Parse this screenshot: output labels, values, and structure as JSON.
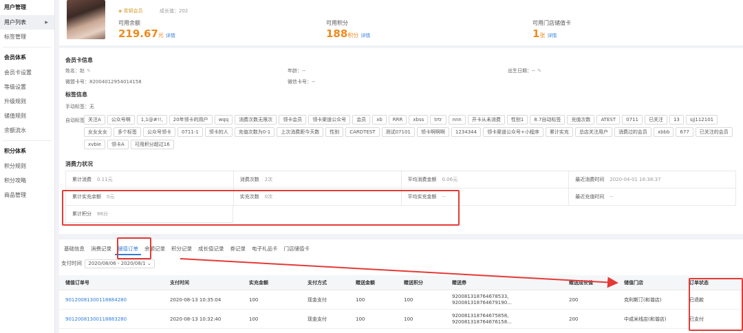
{
  "sidebar": {
    "groups": [
      {
        "title": "用户管理",
        "items": [
          "用户列表",
          "标签管理"
        ]
      },
      {
        "title": "会员体系",
        "items": [
          "会员卡设置",
          "等级设置",
          "升级规则",
          "储值规则",
          "余额流水"
        ]
      },
      {
        "title": "积分体系",
        "items": [
          "积分规则",
          "积分攻略",
          "商品管理"
        ]
      }
    ]
  },
  "profile": {
    "vip": "◈ 青铜会员",
    "growth": "成长值：202",
    "balance_label": "可用余额",
    "balance_value": "219.67",
    "balance_unit": "元",
    "points_label": "可用积分",
    "points_value": "188",
    "points_unit": "积分",
    "cards_label": "可用门店储值卡",
    "cards_value": "1",
    "cards_unit": "张",
    "detail_link": "详情"
  },
  "member_info": {
    "title": "会员卡信息",
    "name": "姓名：赵",
    "age": "年龄：--",
    "birthday": "出生日期：--",
    "card_no": "微盟卡号：82004012954014158",
    "wechat_card": "微信卡号：--",
    "edit_icon": "✎"
  },
  "tags_info": {
    "title": "标签信息",
    "manual": "手动标签：无",
    "auto_label": "自动标签：",
    "tags": [
      "关注A",
      "公众号啊",
      "1,1@#!!,",
      "20年领卡的用户",
      "wqq",
      "消费次数无限次",
      "领卡会员",
      "领卡渠道公众号",
      "会员",
      "xb",
      "RRR",
      "xbss",
      "trtr",
      "nnn",
      "开卡从未消费",
      "性别1",
      "8.7自动标签",
      "充值次数",
      "ATEST",
      "0711",
      "已关注",
      "13",
      "sjj112101",
      "女女女女",
      "多个标签",
      "公众号领卡",
      "0711-1",
      "领卡的人",
      "充值次数为0-1",
      "上次消费距今天数",
      "性别",
      "CARDTEST",
      "测试07101",
      "领卡啊啊啊",
      "1234344",
      "领卡渠道公众号+小程序",
      "累计实充",
      "总店关注用户",
      "消费过的会员",
      "xbbb",
      "677",
      "已关注的会员",
      "xvbie",
      "领卡A",
      "可用积分超过16"
    ]
  },
  "consumption": {
    "title": "消费力状况",
    "rows": [
      [
        {
          "label": "累计消费",
          "value": "0.11元"
        },
        {
          "label": "消费次数",
          "value": "2次"
        },
        {
          "label": "平均消费金额",
          "value": "0.06元"
        },
        {
          "label": "最近消费时间",
          "value": "2020-04-01 16:38:37"
        }
      ],
      [
        {
          "label": "累计实充余额",
          "value": "0元"
        },
        {
          "label": "实充次数",
          "value": "0次"
        },
        {
          "label": "平均实充金额",
          "value": "--"
        },
        {
          "label": "最近充值时间",
          "value": "--"
        }
      ],
      [
        {
          "label": "累计积分",
          "value": "86分"
        }
      ]
    ]
  },
  "tabs": [
    "基础信息",
    "消费记录",
    "储值订单",
    "余额记录",
    "积分记录",
    "成长值记录",
    "券记录",
    "电子礼品卡",
    "门店储值卡"
  ],
  "active_tab": 2,
  "filter": {
    "label": "支付时间",
    "value": "2020/08/06 - 2020/08/1",
    "chevron": "⌄"
  },
  "orders": {
    "columns": [
      "储值订单号",
      "支付时间",
      "实充金额",
      "支付方式",
      "赠送金额",
      "赠送积分",
      "赠送券",
      "赠送成长值",
      "储值门店",
      "订单状态"
    ],
    "rows": [
      [
        "90120081300118884280",
        "2020-08-13 10:35:04",
        "100",
        "现金支付",
        "100",
        "100",
        "920081318764678533,\n920081318764679190...",
        "200",
        "克利斯汀(和谐店)",
        "已退款"
      ],
      [
        "90120081300118883280",
        "2020-08-13 10:32:40",
        "100",
        "现金支付",
        "100",
        "100",
        "920081318764675858,\n920081318764676158...",
        "200",
        "中成米线店(和谐店)",
        "已支付"
      ]
    ]
  }
}
